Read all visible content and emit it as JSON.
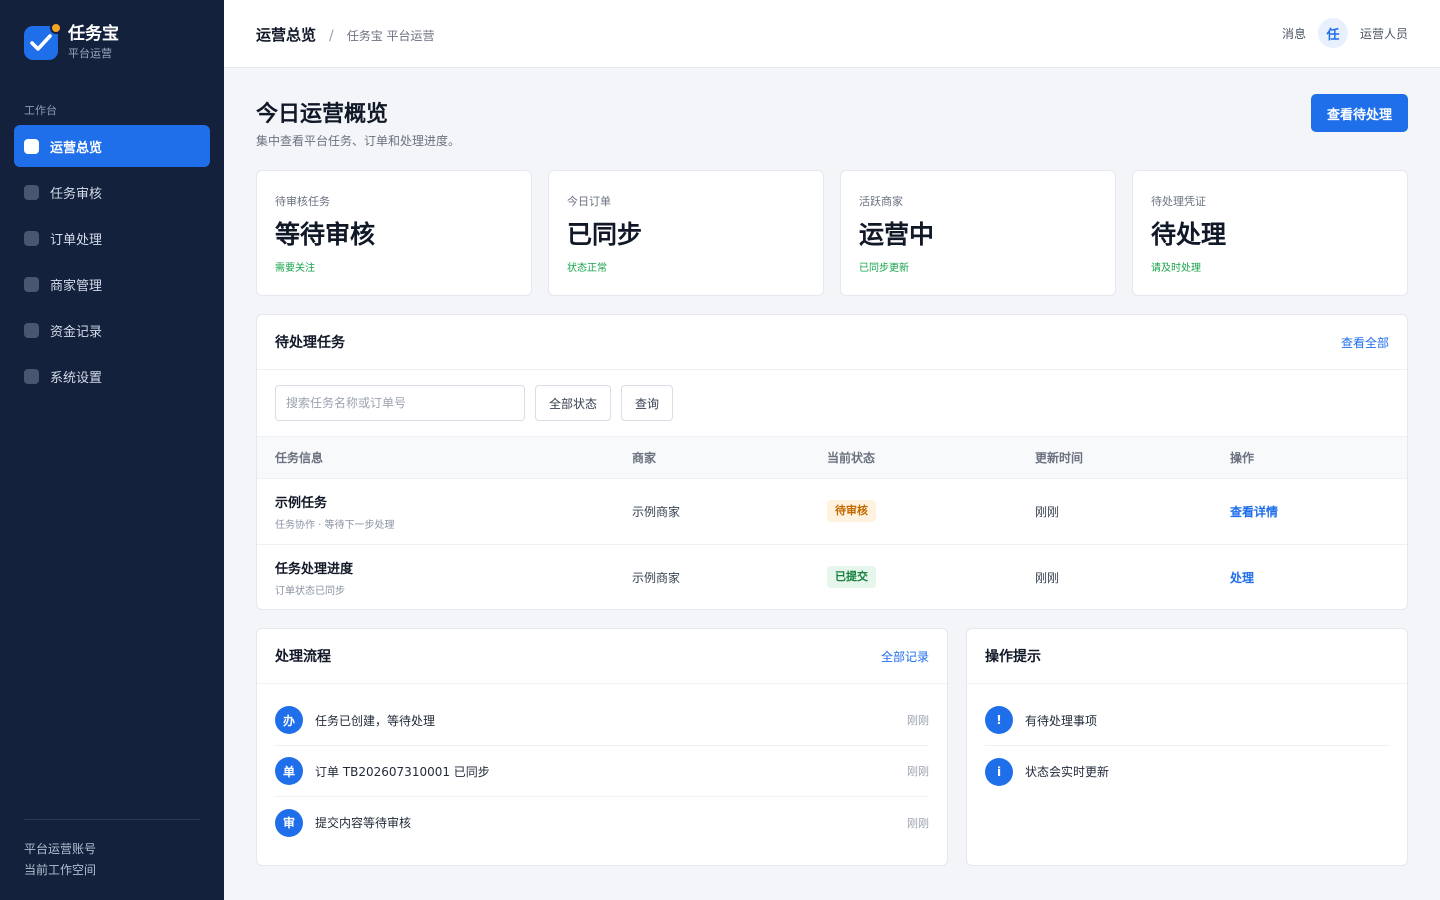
{
  "sidebar": {
    "brand_title": "任务宝",
    "brand_sub": "平台运营",
    "section_label": "工作台",
    "items": [
      {
        "label": "运营总览"
      },
      {
        "label": "任务审核"
      },
      {
        "label": "订单处理"
      },
      {
        "label": "商家管理"
      },
      {
        "label": "资金记录"
      },
      {
        "label": "系统设置"
      }
    ],
    "footer_account": "平台运营账号",
    "footer_workspace": "当前工作空间"
  },
  "header": {
    "breadcrumb_main": "运营总览",
    "breadcrumb_sep": "/",
    "breadcrumb_sub": "任务宝 平台运营",
    "messages_label": "消息",
    "avatar_char": "任",
    "user_role": "运营人员"
  },
  "page": {
    "title": "今日运营概览",
    "subtitle": "集中查看平台任务、订单和处理进度。",
    "primary_button": "查看待处理"
  },
  "stats": [
    {
      "label": "待审核任务",
      "value": "等待审核",
      "note": "需要关注"
    },
    {
      "label": "今日订单",
      "value": "已同步",
      "note": "状态正常"
    },
    {
      "label": "活跃商家",
      "value": "运营中",
      "note": "已同步更新"
    },
    {
      "label": "待处理凭证",
      "value": "待处理",
      "note": "请及时处理"
    }
  ],
  "tasks": {
    "title": "待处理任务",
    "view_all": "查看全部",
    "search_placeholder": "搜索任务名称或订单号",
    "status_filter": "全部状态",
    "query_button": "查询",
    "columns": [
      "任务信息",
      "商家",
      "当前状态",
      "更新时间",
      "操作"
    ],
    "rows": [
      {
        "name": "示例任务",
        "desc": "任务协作 · 等待下一步处理",
        "merchant": "示例商家",
        "status": "待审核",
        "updated": "刚刚",
        "action": "查看详情"
      },
      {
        "name": "任务处理进度",
        "desc": "订单状态已同步",
        "merchant": "示例商家",
        "status": "已提交",
        "updated": "刚刚",
        "action": "处理"
      }
    ]
  },
  "flow": {
    "title": "处理流程",
    "link": "全部记录",
    "items": [
      {
        "icon": "办",
        "text": "任务已创建，等待处理",
        "time": "刚刚"
      },
      {
        "icon": "单",
        "text": "订单 TB202607310001 已同步",
        "time": "刚刚"
      },
      {
        "icon": "审",
        "text": "提交内容等待审核",
        "time": "刚刚"
      }
    ]
  },
  "tips": {
    "title": "操作提示",
    "items": [
      {
        "icon": "!",
        "text": "有待处理事项"
      },
      {
        "icon": "i",
        "text": "状态会实时更新"
      }
    ]
  },
  "colors": {
    "sidebar_bg": "#13213d",
    "accent": "#1f6feb",
    "success": "#16a34a",
    "warning": "#c26a00",
    "page_bg": "#f3f5f8"
  }
}
